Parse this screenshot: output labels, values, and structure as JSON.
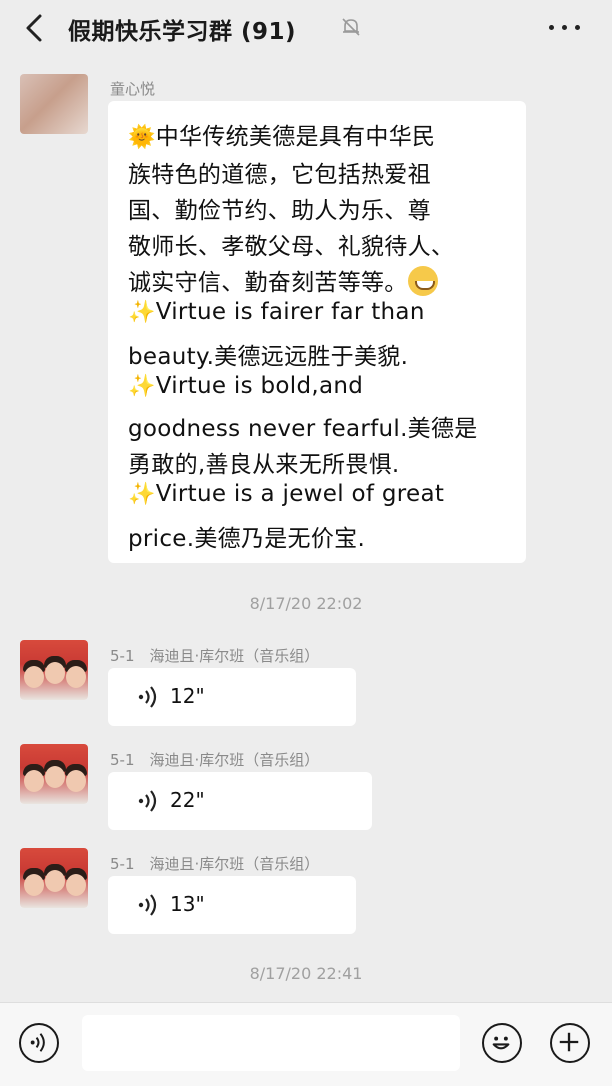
{
  "header": {
    "title": "假期快乐学习群 (91)"
  },
  "messages": {
    "first": {
      "sender": "童心悦",
      "lines": [
        "中华传统美德是具有中华民",
        "族特色的道德，它包括热爱祖",
        "国、勤俭节约、助人为乐、尊",
        "敬师长、孝敬父母、礼貌待人、",
        "诚实守信、勤奋刻苦等等。",
        "Virtue is fairer far than",
        "beauty.美德远远胜于美貌.",
        "Virtue is bold,and",
        "goodness never fearful.美德是",
        "勇敢的,善良从来无所畏惧.",
        "Virtue is a jewel of great",
        "price.美德乃是无价宝."
      ],
      "sun_emoji": "🌞",
      "sparkle_emoji": "✨"
    },
    "timestamp1": "8/17/20 22:02",
    "voice": [
      {
        "sender": "5-1　海迪且·库尔班（音乐组）",
        "duration": "12\""
      },
      {
        "sender": "5-1　海迪且·库尔班（音乐组）",
        "duration": "22\""
      },
      {
        "sender": "5-1　海迪且·库尔班（音乐组）",
        "duration": "13\""
      }
    ],
    "timestamp2": "8/17/20 22:41"
  },
  "icons": {
    "back": "chevron-left-icon",
    "mute": "bell-off-icon",
    "more": "more-dots-icon",
    "voice_input": "voice-icon",
    "emoji": "smiley-icon",
    "plus": "plus-icon"
  },
  "colors": {
    "background": "#ededed",
    "bubble": "#ffffff",
    "text": "#111111",
    "meta": "#8a8a8a"
  }
}
